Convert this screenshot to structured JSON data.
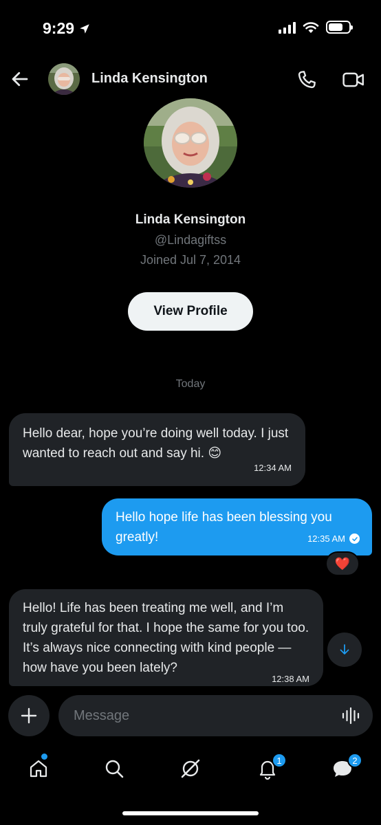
{
  "status": {
    "time": "9:29"
  },
  "header": {
    "name": "Linda Kensington"
  },
  "profile": {
    "name": "Linda Kensington",
    "handle": "@Lindagiftss",
    "joined": "Joined Jul 7, 2014",
    "view_profile_label": "View Profile"
  },
  "conversation": {
    "date_separator": "Today",
    "messages": [
      {
        "direction": "incoming",
        "text": "Hello dear, hope you’re doing well today. I just wanted to reach out and say hi. 😊",
        "time": "12:34 AM"
      },
      {
        "direction": "outgoing",
        "text": "Hello hope life has been blessing you greatly!",
        "time": "12:35 AM",
        "reaction": "❤️"
      },
      {
        "direction": "incoming",
        "text": "Hello! Life has been treating me well, and I’m truly grateful for that. I hope the same for you too. It’s always nice connecting with kind people — how have you been lately?",
        "time": "12:38 AM"
      }
    ]
  },
  "composer": {
    "placeholder": "Message"
  },
  "tabbar": {
    "notifications_badge": "1",
    "messages_badge": "2"
  },
  "colors": {
    "accent": "#1d9bf0",
    "background": "#000000",
    "bubble_incoming": "#202327"
  },
  "icons": [
    "back-arrow-icon",
    "phone-icon",
    "video-icon",
    "location-arrow-icon",
    "signal-icon",
    "wifi-icon",
    "battery-icon",
    "checkmark-icon",
    "arrow-down-icon",
    "plus-icon",
    "voice-icon",
    "home-icon",
    "search-icon",
    "grok-icon",
    "bell-icon",
    "messages-icon"
  ]
}
